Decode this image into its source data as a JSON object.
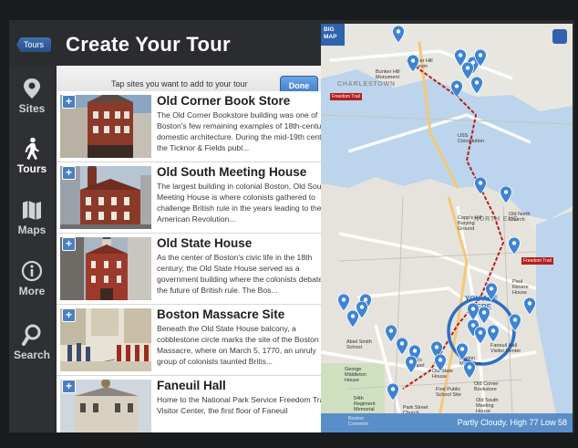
{
  "header": {
    "back_label": "Tours",
    "title": "Create Your Tour"
  },
  "sidebar": {
    "items": [
      {
        "label": "Sites",
        "icon": "location-pin-icon"
      },
      {
        "label": "Tours",
        "icon": "walking-person-icon",
        "active": true
      },
      {
        "label": "Maps",
        "icon": "map-icon"
      },
      {
        "label": "More",
        "icon": "info-icon"
      },
      {
        "label": "Search",
        "icon": "search-icon"
      }
    ]
  },
  "list": {
    "instruction": "Tap sites you want to add to your tour",
    "done_label": "Done",
    "add_symbol": "+",
    "sites": [
      {
        "name": "Old Corner Book Store",
        "description": "The Old Corner Bookstore building was one of Boston's few remaining examples of 18th-century domestic architecture. During the mid-19th century the Ticknor & Fields publ..."
      },
      {
        "name": "Old South Meeting House",
        "description": "The largest building in colonial Boston, Old South Meeting House is where colonists gathered to challenge British rule in the years leading to the American Revolution..."
      },
      {
        "name": "Old State House",
        "description": "As the center of Boston's civic life in the 18th century, the Old State House served as a government building where the colonists debated the future of British rule. The Bos..."
      },
      {
        "name": "Boston Massacre Site",
        "description": "Beneath the Old State House balcony, a cobblestone circle marks the site of the Boston Massacre, where on March 5, 1770, an unruly group of colonists taunted Britis..."
      },
      {
        "name": "Faneuil Hall",
        "description": "Home to the National Park Service Freedom Trail Visitor Center, the first floor of Faneuil"
      }
    ]
  },
  "map": {
    "big_map_label": "BIG MAP",
    "you_are_here": "YOU ARE HERE",
    "weather": "Partly Cloudy. High 77 Low 58",
    "freedom_trail": "Freedom Trail",
    "labels": [
      "Bunker Hill Museum",
      "Bunker Hill Monument",
      "CHARLESTOWN",
      "USS Constitution",
      "Copp's Hill Burying Ground",
      "Old North Church",
      "NORTH END",
      "Paul Revere House",
      "Faneuil Hall Visitor Center",
      "Boston Massacre",
      "Old State House",
      "Old Corner Bookstore",
      "Old South Meeting House",
      "First Public School Site",
      "King's Chapel",
      "Park Street Church",
      "Boston Common",
      "54th Regiment Memorial",
      "George Middleton House",
      "Abiel Smith School"
    ]
  },
  "colors": {
    "accent": "#3c79c4",
    "marker": "#3d84d6",
    "freedom_trail": "#b3201f"
  }
}
